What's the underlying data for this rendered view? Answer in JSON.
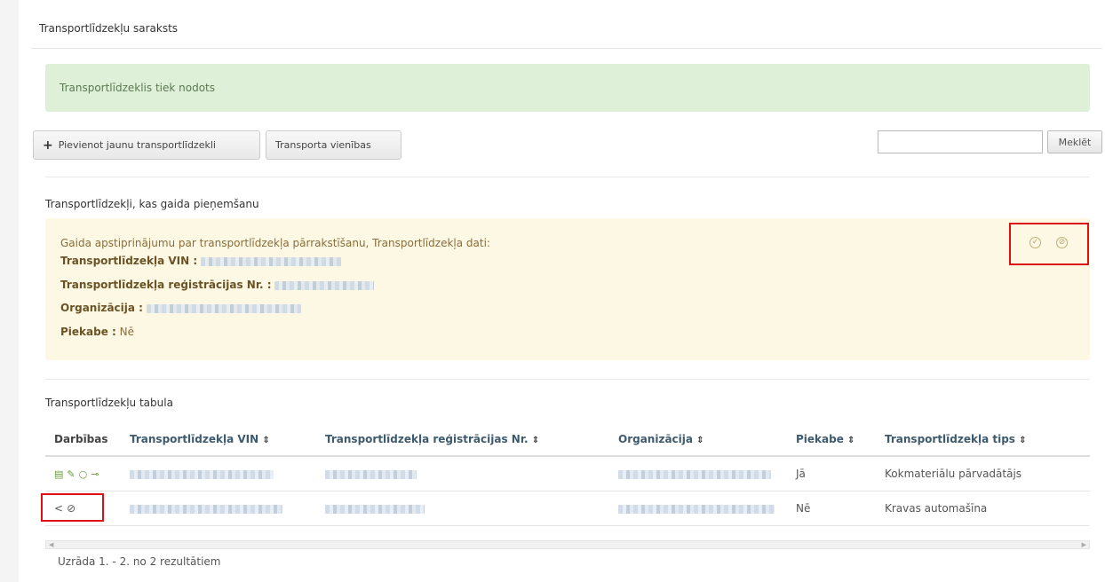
{
  "page_title": "Transportlīdzekļu saraksts",
  "success_alert": "Transportlīdzeklis tiek nodots",
  "toolbar": {
    "add_label": "Pievienot jaunu transportlīdzekli",
    "units_label": "Transporta vienības",
    "search_value": "",
    "search_button": "Meklēt"
  },
  "pending": {
    "title": "Transportlīdzekļi, kas gaida pieņemšanu",
    "message": "Gaida apstiprinājumu par transportlīdzekļa pārrakstīšanu, Transportlīdzekļa dati:",
    "vin_label": "Transportlīdzekļa VIN :",
    "reg_label": "Transportlīdzekļa reģistrācijas Nr. :",
    "org_label": "Organizācija :",
    "trailer_label": "Piekabe :",
    "trailer_value": "Nē",
    "icons": [
      "accept-icon",
      "reject-icon"
    ]
  },
  "table": {
    "title": "Transportlīdzekļu tabula",
    "columns": [
      "Darbības",
      "Transportlīdzekļa VIN",
      "Transportlīdzekļa reģistrācijas Nr.",
      "Organizācija",
      "Piekabe",
      "Transportlīdzekļa tips"
    ],
    "sort_glyph": "⇕",
    "rows": [
      {
        "actions": [
          "list-icon",
          "edit-icon",
          "circle-icon",
          "key-icon"
        ],
        "trailer": "Jā",
        "type": "Kokmateriālu pārvadātājs"
      },
      {
        "actions": [
          "share-icon",
          "cancel-icon"
        ],
        "trailer": "Nē",
        "type": "Kravas automašīna"
      }
    ]
  },
  "footer": "Uzrāda 1. - 2. no 2 rezultātiem",
  "colors": {
    "success_bg": "#dff0d8",
    "warning_bg": "#fcf8e3",
    "highlight": "#dd1111"
  }
}
